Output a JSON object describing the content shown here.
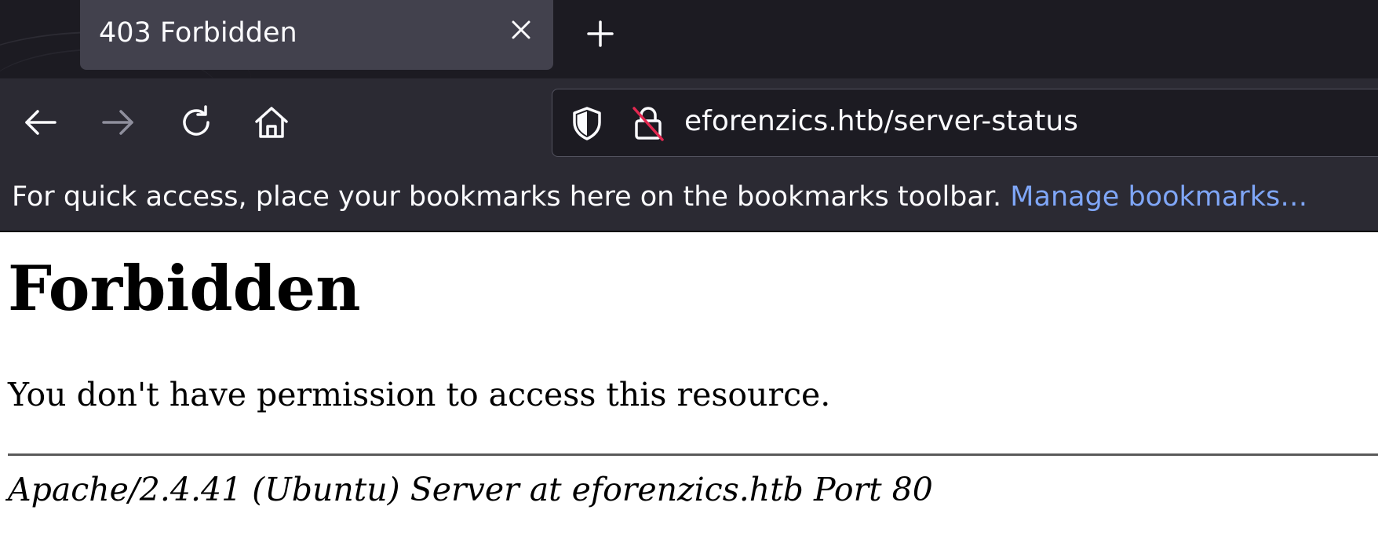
{
  "tab": {
    "title": "403 Forbidden",
    "close_icon": "close-icon",
    "new_tab_icon": "plus-icon"
  },
  "navbar": {
    "back_icon": "arrow-left-icon",
    "forward_icon": "arrow-right-icon",
    "reload_icon": "reload-icon",
    "home_icon": "home-icon",
    "url": "eforenzics.htb/server-status",
    "tracking_icon": "shield-icon",
    "security_icon": "insecure-lock-icon"
  },
  "bookmarks_bar": {
    "message": "For quick access, place your bookmarks here on the bookmarks toolbar.",
    "manage_link": "Manage bookmarks…"
  },
  "page": {
    "heading": "Forbidden",
    "message": "You don't have permission to access this resource.",
    "signature": "Apache/2.4.41 (Ubuntu) Server at eforenzics.htb Port 80"
  },
  "colors": {
    "tabstrip_bg": "#1c1b22",
    "toolbar_bg": "#2b2a33",
    "active_tab_bg": "#42414d",
    "link": "#7fa6f7",
    "text_light": "#fbfbfe"
  }
}
